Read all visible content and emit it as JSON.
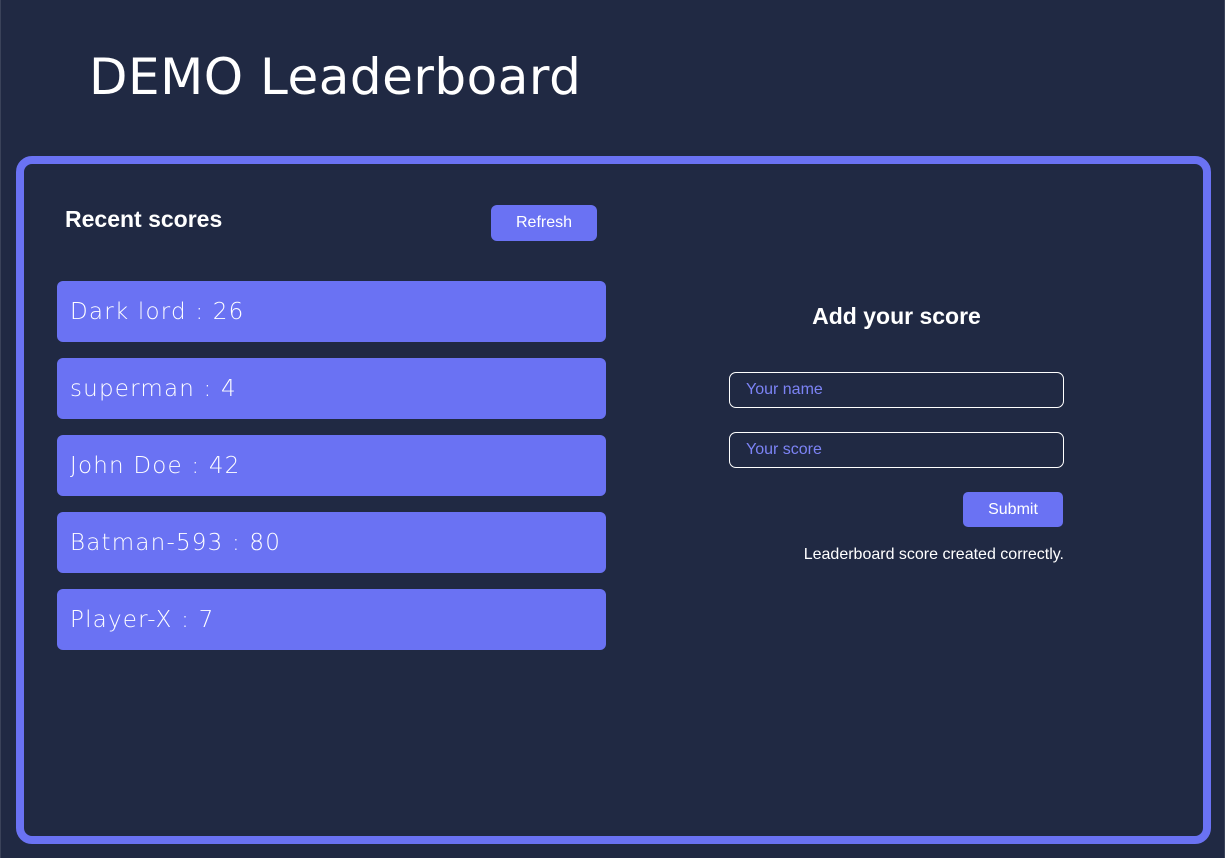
{
  "page": {
    "title": "DEMO Leaderboard"
  },
  "colors": {
    "background": "#202943",
    "accent": "#6a72f3",
    "text": "#ffffff",
    "placeholder": "#7c83f5"
  },
  "recent": {
    "title": "Recent scores",
    "refresh_label": "Refresh",
    "scores": [
      "Dark lord : 26",
      "superman : 4",
      "John Doe : 42",
      "Batman-593 : 80",
      "Player-X : 7"
    ]
  },
  "form": {
    "title": "Add your score",
    "name_placeholder": "Your name",
    "name_value": "",
    "score_placeholder": "Your score",
    "score_value": "",
    "submit_label": "Submit",
    "status_message": "Leaderboard score created correctly."
  }
}
